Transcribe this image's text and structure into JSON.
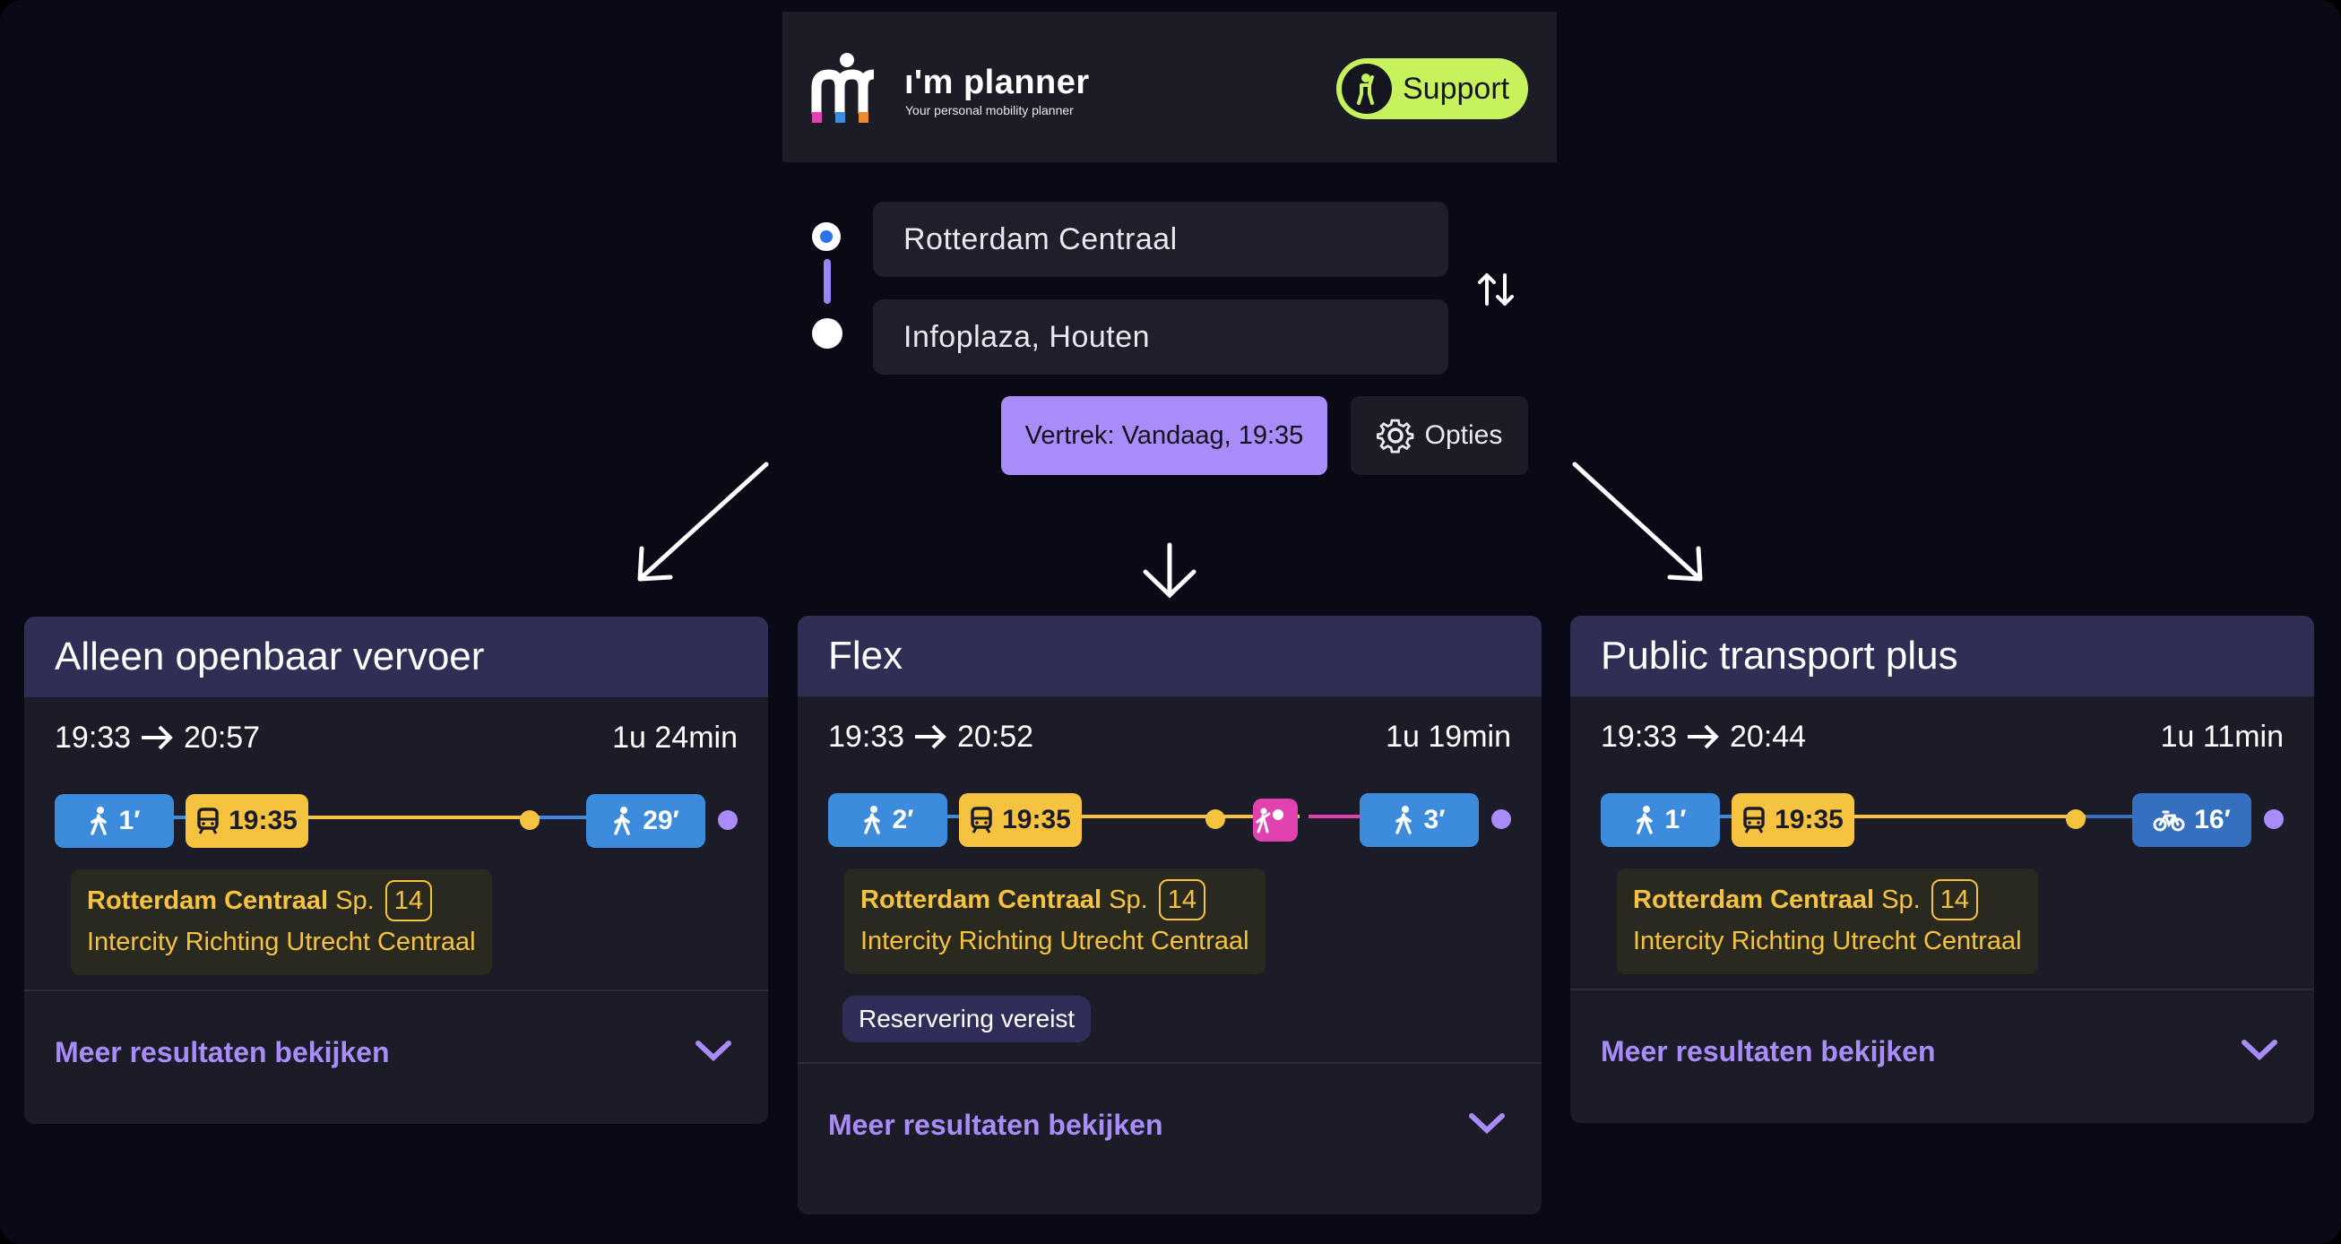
{
  "header": {
    "brand": "ı'm planner",
    "tagline": "Your personal mobility planner",
    "support_label": "Support",
    "colors": {
      "support_bg": "#c6f35b",
      "accent": "#a98cf7"
    }
  },
  "search": {
    "from": "Rotterdam Centraal",
    "to": "Infoplaza, Houten",
    "depart_label": "Vertrek: Vandaag, 19:35",
    "options_label": "Opties"
  },
  "cards": [
    {
      "title": "Alleen openbaar vervoer",
      "depart": "19:33",
      "arrive": "20:57",
      "duration": "1u 24min",
      "legs": {
        "walk1": "1′",
        "train": "19:35",
        "last": "29′"
      },
      "station": "Rotterdam Centraal",
      "platform_prefix": "Sp.",
      "platform": "14",
      "service": "Intercity Richting Utrecht Centraal",
      "more": "Meer resultaten bekijken"
    },
    {
      "title": "Flex",
      "depart": "19:33",
      "arrive": "20:52",
      "duration": "1u 19min",
      "legs": {
        "walk1": "2′",
        "train": "19:35",
        "last": "3′"
      },
      "station": "Rotterdam Centraal",
      "platform_prefix": "Sp.",
      "platform": "14",
      "service": "Intercity Richting Utrecht Centraal",
      "badge": "Reservering vereist",
      "more": "Meer resultaten bekijken"
    },
    {
      "title": "Public transport plus",
      "depart": "19:33",
      "arrive": "20:44",
      "duration": "1u 11min",
      "legs": {
        "walk1": "1′",
        "train": "19:35",
        "last": "16′"
      },
      "station": "Rotterdam Centraal",
      "platform_prefix": "Sp.",
      "platform": "14",
      "service": "Intercity Richting Utrecht Centraal",
      "more": "Meer resultaten bekijken"
    }
  ],
  "icons": [
    "logo-icon",
    "person-icon",
    "swap-icon",
    "gear-icon",
    "walk-icon",
    "train-icon",
    "bike-icon",
    "flex-icon",
    "arrow-right-icon",
    "chevron-down-icon"
  ]
}
